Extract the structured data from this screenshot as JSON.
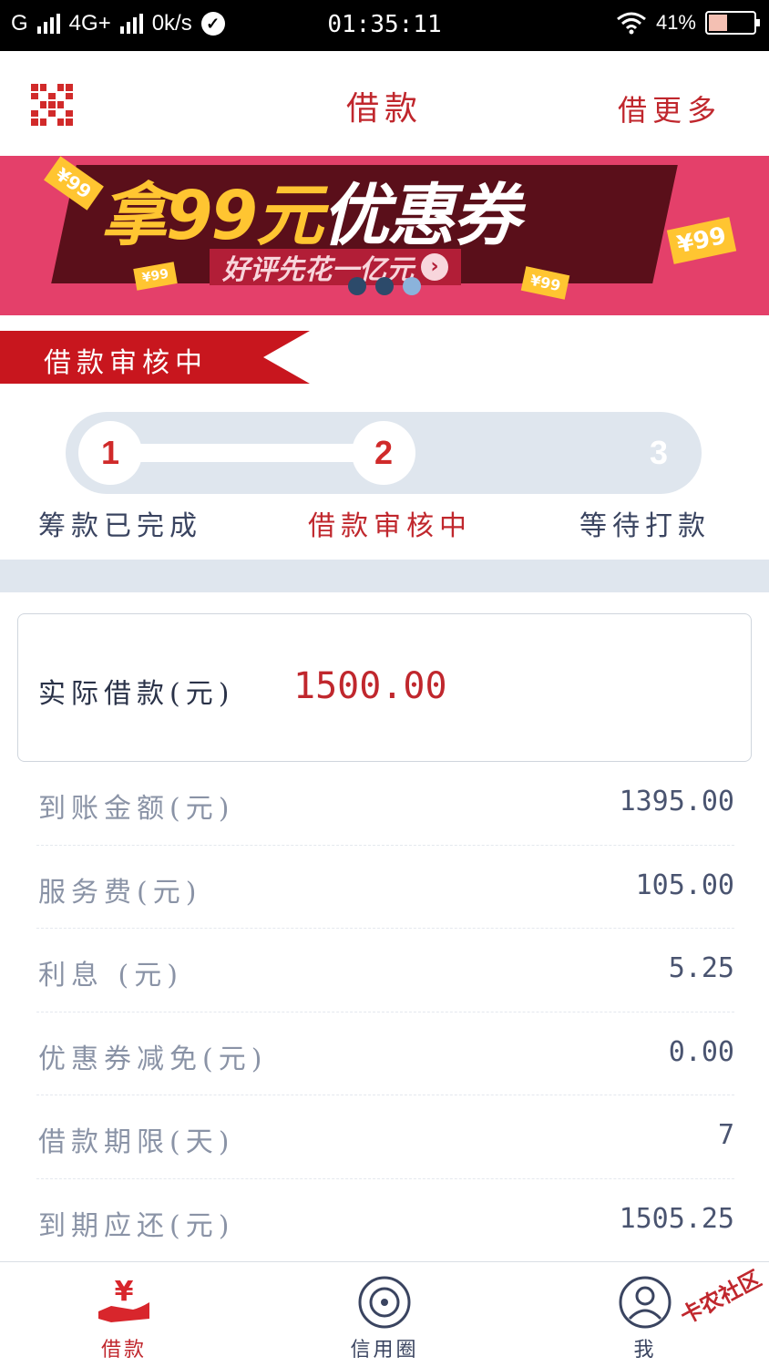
{
  "status_bar": {
    "carrier": "G",
    "network": "4G+",
    "speed": "0k/s",
    "time": "01:35:11",
    "battery": "41%",
    "battery_level": 0.41
  },
  "header": {
    "title": "借款",
    "right_link": "借更多",
    "left_icon": "qr-code-icon"
  },
  "banner": {
    "headline_yellow": "拿99元",
    "headline_white": "优惠券",
    "subtitle": "好评先花一亿元",
    "tags": [
      "¥99",
      "¥99",
      "¥99",
      "¥99"
    ],
    "active_dot": 2
  },
  "status_ribbon": "借款审核中",
  "steps": [
    {
      "number": "1",
      "label": "筹款已完成"
    },
    {
      "number": "2",
      "label": "借款审核中"
    },
    {
      "number": "3",
      "label": "等待打款"
    }
  ],
  "amount": {
    "label": "实际借款(元)",
    "value": "1500.00"
  },
  "details": [
    {
      "label": "到账金额(元)",
      "value": "1395.00"
    },
    {
      "label": "服务费(元)",
      "value": "105.00"
    },
    {
      "label": "利息 (元)",
      "value": "5.25"
    },
    {
      "label": "优惠券减免(元)",
      "value": "0.00"
    },
    {
      "label": "借款期限(天)",
      "value": "7"
    },
    {
      "label": "到期应还(元)",
      "value": "1505.25"
    }
  ],
  "bottom_nav": [
    {
      "label": "借款",
      "icon": "yen-hand-icon"
    },
    {
      "label": "信用圈",
      "icon": "credit-circle-icon"
    },
    {
      "label": "我",
      "icon": "user-icon"
    }
  ],
  "watermark": "卡农社区",
  "colors": {
    "accent": "#c0272d",
    "banner_bg": "#e4406a",
    "ribbon": "#c8161e",
    "track": "#dfe6ee"
  }
}
